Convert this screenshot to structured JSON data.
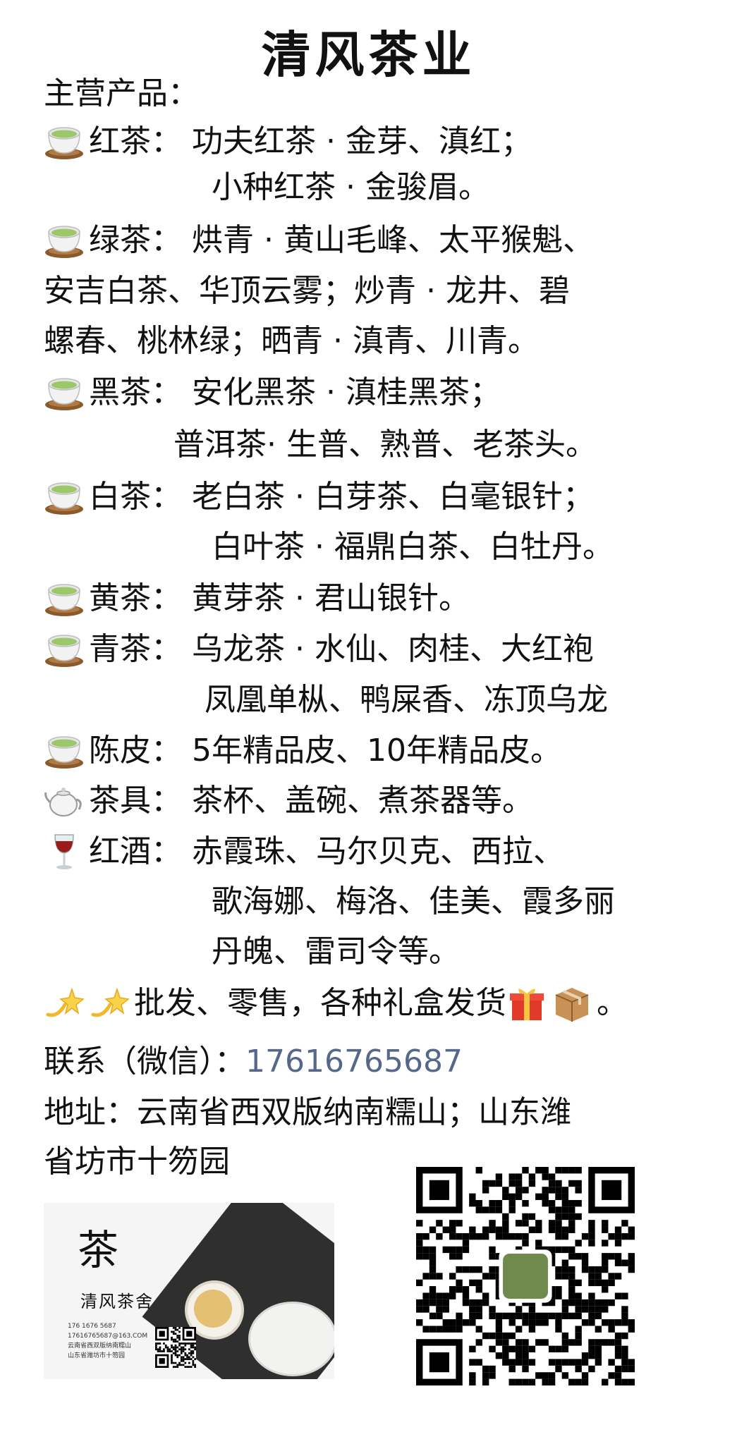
{
  "title": "清风茶业",
  "heading": "主营产品：",
  "products": {
    "red_tea": {
      "icon": "tea-cup-icon",
      "line1": "红茶：  功夫红茶 · 金芽、滇红；",
      "line2": "小种红茶 · 金骏眉。"
    },
    "green_tea": {
      "icon": "tea-cup-icon",
      "line1": "绿茶：  烘青 · 黄山毛峰、太平猴魁、",
      "line2": "安吉白茶、华顶云雾；炒青 · 龙井、碧",
      "line3": "螺春、桃林绿；晒青 · 滇青、川青。"
    },
    "dark_tea": {
      "icon": "tea-cup-icon",
      "line1": "黑茶：  安化黑茶 · 滇桂黑茶；",
      "line2": "普洱茶· 生普、熟普、老茶头。"
    },
    "white_tea": {
      "icon": "tea-cup-icon",
      "line1": "白茶：  老白茶 · 白芽茶、白毫银针；",
      "line2": "白叶茶 · 福鼎白茶、白牡丹。"
    },
    "yellow_tea": {
      "icon": "tea-cup-icon",
      "line1": "黄茶：  黄芽茶 · 君山银针。"
    },
    "oolong_tea": {
      "icon": "tea-cup-icon",
      "line1": "青茶：  乌龙茶 · 水仙、肉桂、大红袍",
      "line2": "凤凰单枞、鸭屎香、冻顶乌龙"
    },
    "tangerine_peel": {
      "icon": "tea-cup-icon",
      "line1": "陈皮：  5年精品皮、10年精品皮。"
    },
    "teaware": {
      "icon": "teapot-icon",
      "line1": "茶具：  茶杯、盖碗、煮茶器等。"
    },
    "red_wine": {
      "icon": "wine-glass-icon",
      "line1": "红酒：  赤霞珠、马尔贝克、西拉、",
      "line2": "歌海娜、梅洛、佳美、霞多丽",
      "line3": "丹魄、雷司令等。"
    }
  },
  "wholesale": {
    "icons": [
      "dizzy-star-icon",
      "dizzy-star-icon",
      "gift-icon",
      "package-icon"
    ],
    "text": "批发、零售，各种礼盒发货",
    "end": "。"
  },
  "contact": {
    "label": "联系（微信）：",
    "phone": "17616765687"
  },
  "address": {
    "line1": "地址：云南省西双版纳南糯山；山东潍",
    "line2": "省坊市十笏园"
  },
  "business_card": {
    "mark": "茶",
    "name": "清风茶舍",
    "phone": "176 1676 5687",
    "email": "17616765687@163.COM",
    "addr1": "云南省西双版纳南糯山",
    "addr2": "山东省潍坊市十笏园"
  },
  "colors": {
    "text": "#111111",
    "phone": "#56688a",
    "cup_tea": "#9cc86a",
    "cup_saucer": "#8a5a2b"
  }
}
